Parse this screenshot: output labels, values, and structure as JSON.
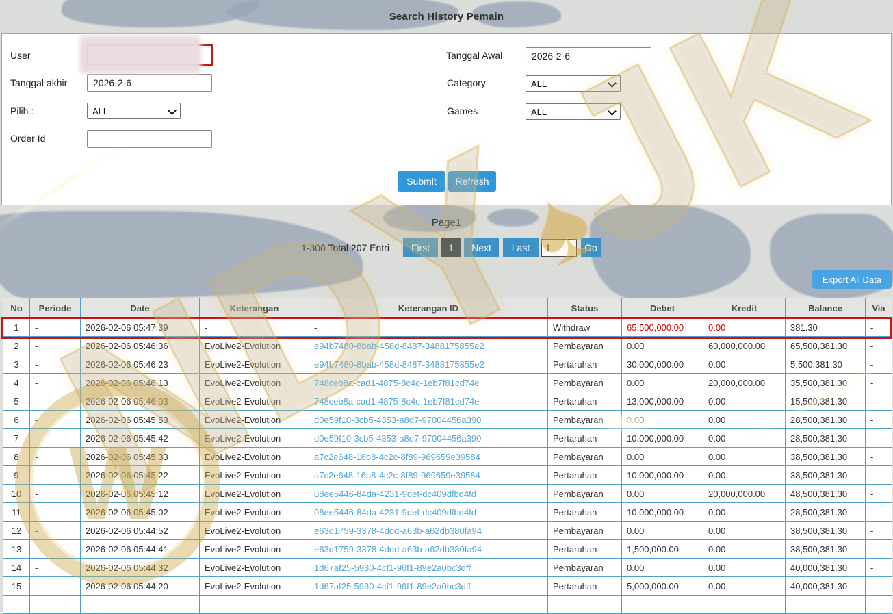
{
  "title": "Search History Pemain",
  "form": {
    "user_label": "User",
    "tanggal_awal_label": "Tanggal Awal",
    "tanggal_awal_value": "2026-2-6",
    "tanggal_akhir_label": "Tanggal akhir",
    "tanggal_akhir_value": "2026-2-6",
    "category_label": "Category",
    "category_value": "ALL",
    "pilih_label": "Pilih  :",
    "pilih_value": "ALL",
    "games_label": "Games",
    "games_value": "ALL",
    "order_id_label": "Order Id",
    "order_id_value": "",
    "submit_label": "Submit",
    "refresh_label": "Refresh"
  },
  "pagination": {
    "page_label": "Page1",
    "range_text": "1-300 Total 207 Entri",
    "first_label": "First",
    "current_page": "1",
    "next_label": "Next",
    "last_label": "Last",
    "goto_value": "1",
    "go_label": "Go"
  },
  "export_label": "Export All Data",
  "watermark": {
    "letters": "NDY",
    "letters2": "JK",
    "spade": "♠",
    "emblem_letter": "W"
  },
  "colors": {
    "accent_blue": "#2e98da",
    "pagination_blue": "#3a92c9",
    "active_page_bg": "#14293c",
    "export_blue": "#4aa3e2",
    "table_border": "#4e9fca",
    "link_blue": "#55a6d8",
    "annotation_red": "#cf1111",
    "value_red": "#dd0000"
  },
  "table": {
    "headers": [
      "No",
      "Periode",
      "Date",
      "Keterangan",
      "Keterangan ID",
      "Status",
      "Debet",
      "Kredit",
      "Balance",
      "Via"
    ],
    "highlighted_row_index": 0,
    "red_cell_columns": [
      6,
      7
    ],
    "rows": [
      [
        "1",
        "-",
        "2026-02-06 05:47:39",
        "-",
        "-",
        "Withdraw",
        "65,500,000.00",
        "0.00",
        "381.30",
        "-"
      ],
      [
        "2",
        "-",
        "2026-02-06 05:46:36",
        "EvoLive2-Evolution",
        "e94b7480-8bab-458d-8487-3488175855e2",
        "Pembayaran",
        "0.00",
        "60,000,000.00",
        "65,500,381.30",
        "-"
      ],
      [
        "3",
        "-",
        "2026-02-06 05:46:23",
        "EvoLive2-Evolution",
        "e94b7480-8bab-458d-8487-3488175855e2",
        "Pertaruhan",
        "30,000,000.00",
        "0.00",
        "5,500,381.30",
        "-"
      ],
      [
        "4",
        "-",
        "2026-02-06 05:46:13",
        "EvoLive2-Evolution",
        "748ceb8a-cad1-4875-8c4c-1eb7f81cd74e",
        "Pembayaran",
        "0.00",
        "20,000,000.00",
        "35,500,381.30",
        "-"
      ],
      [
        "5",
        "-",
        "2026-02-06 05:46:03",
        "EvoLive2-Evolution",
        "748ceb8a-cad1-4875-8c4c-1eb7f81cd74e",
        "Pertaruhan",
        "13,000,000.00",
        "0.00",
        "15,500,381.30",
        "-"
      ],
      [
        "6",
        "-",
        "2026-02-06 05:45:53",
        "EvoLive2-Evolution",
        "d0e59f10-3cb5-4353-a8d7-97004456a390",
        "Pembayaran",
        "0.00",
        "0.00",
        "28,500,381.30",
        "-"
      ],
      [
        "7",
        "-",
        "2026-02-06 05:45:42",
        "EvoLive2-Evolution",
        "d0e59f10-3cb5-4353-a8d7-97004456a390",
        "Pertaruhan",
        "10,000,000.00",
        "0.00",
        "28,500,381.30",
        "-"
      ],
      [
        "8",
        "-",
        "2026-02-06 05:45:33",
        "EvoLive2-Evolution",
        "a7c2e648-16b8-4c2c-8f89-969659e39584",
        "Pembayaran",
        "0.00",
        "0.00",
        "38,500,381.30",
        "-"
      ],
      [
        "9",
        "-",
        "2026-02-06 05:45:22",
        "EvoLive2-Evolution",
        "a7c2e648-16b8-4c2c-8f89-969659e39584",
        "Pertaruhan",
        "10,000,000.00",
        "0.00",
        "38,500,381.30",
        "-"
      ],
      [
        "10",
        "-",
        "2026-02-06 05:45:12",
        "EvoLive2-Evolution",
        "08ee5446-84da-4231-9def-dc409dfbd4fd",
        "Pembayaran",
        "0.00",
        "20,000,000.00",
        "48,500,381.30",
        "-"
      ],
      [
        "11",
        "-",
        "2026-02-06 05:45:02",
        "EvoLive2-Evolution",
        "08ee5446-84da-4231-9def-dc409dfbd4fd",
        "Pertaruhan",
        "10,000,000.00",
        "0.00",
        "28,500,381.30",
        "-"
      ],
      [
        "12",
        "-",
        "2026-02-06 05:44:52",
        "EvoLive2-Evolution",
        "e63d1759-3378-4ddd-a63b-a62db380fa94",
        "Pembayaran",
        "0.00",
        "0.00",
        "38,500,381.30",
        "-"
      ],
      [
        "13",
        "-",
        "2026-02-06 05:44:41",
        "EvoLive2-Evolution",
        "e63d1759-3378-4ddd-a63b-a62db380fa94",
        "Pertaruhan",
        "1,500,000.00",
        "0.00",
        "38,500,381.30",
        "-"
      ],
      [
        "14",
        "-",
        "2026-02-06 05:44:32",
        "EvoLive2-Evolution",
        "1d67af25-5930-4cf1-96f1-89e2a0bc3dff",
        "Pembayaran",
        "0.00",
        "0.00",
        "40,000,381.30",
        "-"
      ],
      [
        "15",
        "-",
        "2026-02-06 05:44:20",
        "EvoLive2-Evolution",
        "1d67af25-5930-4cf1-96f1-89e2a0bc3dff",
        "Pertaruhan",
        "5,000,000.00",
        "0.00",
        "40,000,381.30",
        "-"
      ]
    ]
  }
}
